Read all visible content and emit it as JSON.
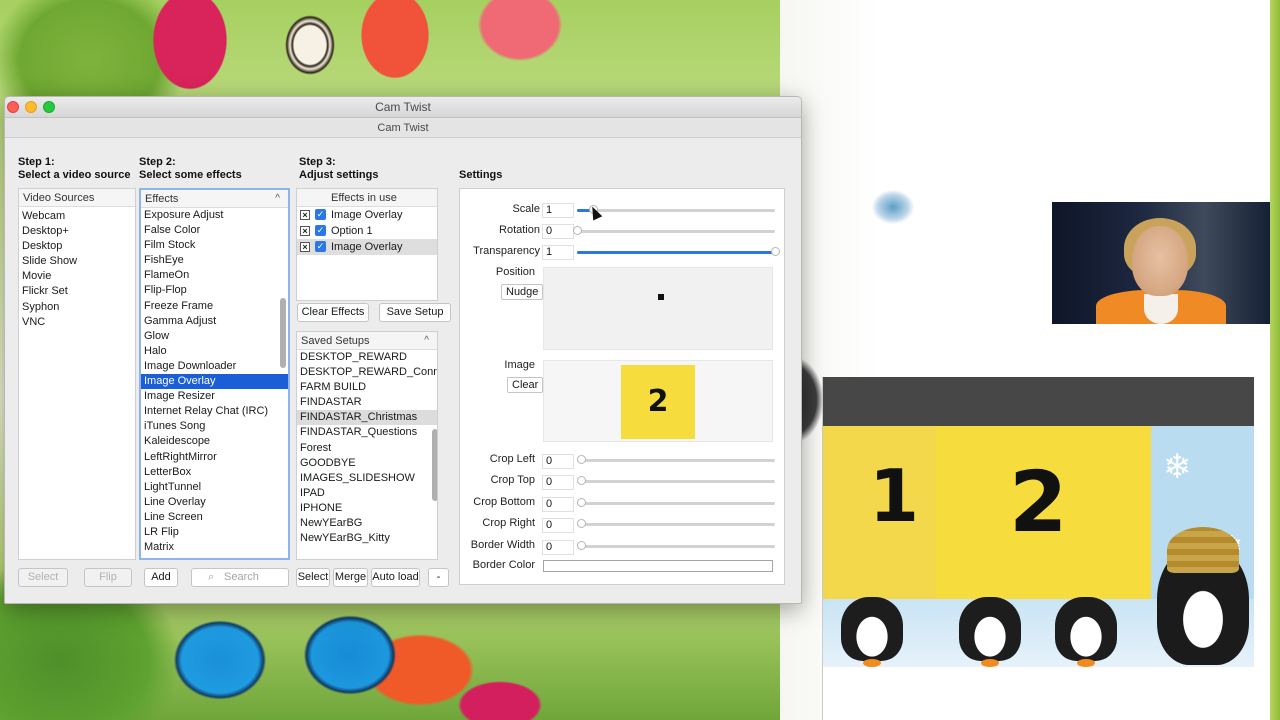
{
  "window": {
    "title": "Cam Twist",
    "toolbar_title": "Cam Twist"
  },
  "steps": {
    "step1": {
      "line1": "Step 1:",
      "line2": "Select a video source"
    },
    "step2": {
      "line1": "Step 2:",
      "line2": "Select some effects"
    },
    "step3": {
      "line1": "Step 3:",
      "line2": "Adjust settings"
    },
    "settings": "Settings"
  },
  "sources": {
    "header": "Video Sources",
    "items": [
      "Webcam",
      "Desktop+",
      "Desktop",
      "Slide Show",
      "Movie",
      "Flickr Set",
      "Syphon",
      "VNC"
    ]
  },
  "effects": {
    "header": "Effects",
    "selected": "Image Overlay",
    "items": [
      "Exposure Adjust",
      "False Color",
      "Film Stock",
      "FishEye",
      "FlameOn",
      "Flip-Flop",
      "Freeze Frame",
      "Gamma Adjust",
      "Glow",
      "Halo",
      "Image Downloader",
      "Image Overlay",
      "Image Resizer",
      "Internet Relay Chat (IRC)",
      "iTunes Song",
      "Kaleidescope",
      "LeftRightMirror",
      "LetterBox",
      "LightTunnel",
      "Line Overlay",
      "Line Screen",
      "LR Flip",
      "Matrix"
    ]
  },
  "effects_in_use": {
    "header": "Effects in use",
    "items": [
      "Image Overlay",
      "Option 1",
      "Image Overlay"
    ]
  },
  "buttons": {
    "clear_effects": "Clear Effects",
    "save_setup": "Save Setup",
    "select_left": "Select",
    "flip": "Flip",
    "add": "Add",
    "search_placeholder": "Search",
    "select": "Select",
    "merge": "Merge",
    "auto_load": "Auto load",
    "minus": "-"
  },
  "saved_setups": {
    "header": "Saved Setups",
    "highlighted": "FINDASTAR_Christmas",
    "items": [
      "DESKTOP_REWARD",
      "DESKTOP_REWARD_Connect",
      "FARM BUILD",
      "FINDASTAR",
      "FINDASTAR_Christmas",
      "FINDASTAR_Questions",
      "Forest",
      "GOODBYE",
      "IMAGES_SLIDESHOW",
      "IPAD",
      "IPHONE",
      "NewYEarBG",
      "NewYEarBG_Kitty"
    ]
  },
  "settings": {
    "scale": {
      "label": "Scale",
      "value": "1",
      "fraction": 0.08
    },
    "rotation": {
      "label": "Rotation",
      "value": "0",
      "fraction": 0.0
    },
    "transparency": {
      "label": "Transparency",
      "value": "1",
      "fraction": 1.0
    },
    "position_label": "Position",
    "nudge": "Nudge",
    "image_label": "Image",
    "clear": "Clear",
    "image_thumb_text": "2",
    "crops": [
      {
        "label": "Crop Left",
        "value": "0"
      },
      {
        "label": "Crop Top",
        "value": "0"
      },
      {
        "label": "Crop Bottom",
        "value": "0"
      },
      {
        "label": "Crop Right",
        "value": "0"
      },
      {
        "label": "Border Width",
        "value": "0"
      }
    ],
    "border_color_label": "Border Color"
  },
  "slide": {
    "num1": "1",
    "num2": "2"
  },
  "colors": {
    "accent": "#1a5ed8",
    "checkbox": "#2b77e6",
    "slide_yellow": "#f7dc3d",
    "slide_header": "#474747"
  }
}
